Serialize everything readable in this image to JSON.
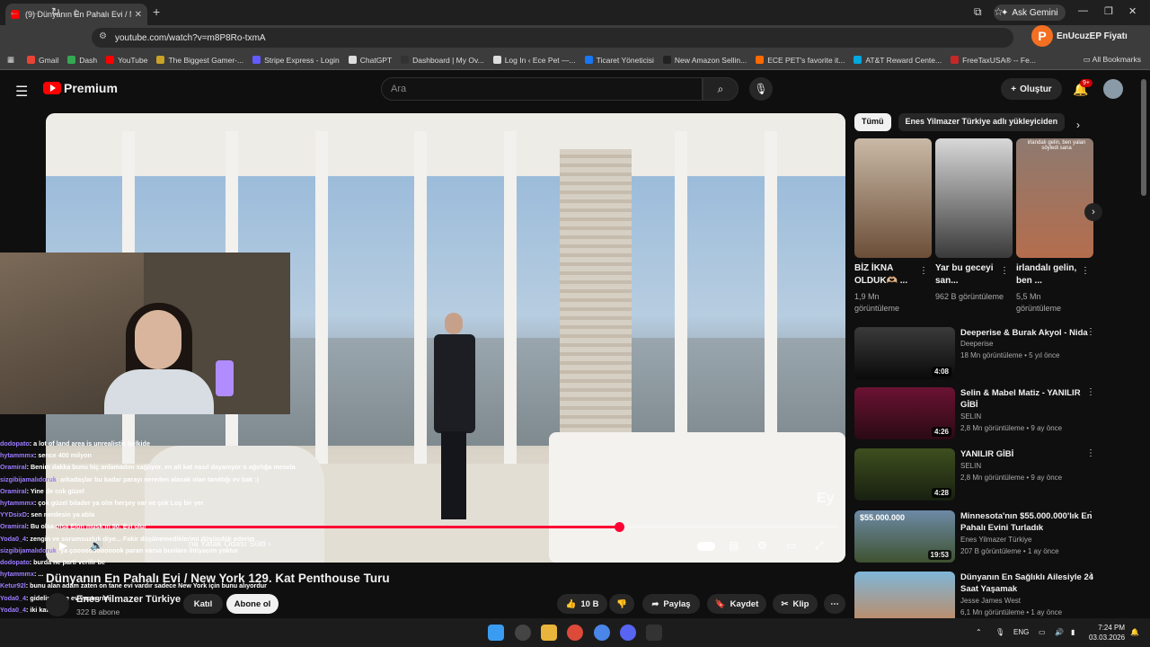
{
  "browser": {
    "tab_title": "(9) Dünyanın En Pahalı Evi / New",
    "url": "youtube.com/watch?v=m8P8Ro-txmA",
    "ask_gemini": "Ask Gemini",
    "extension_label": "EnUcuzEP Fiyatı",
    "bookmarks": [
      "Gmail",
      "Dash",
      "YouTube",
      "The Biggest Gamer-...",
      "Stripe Express - Login",
      "ChatGPT",
      "Dashboard | My Ov...",
      "Log In ‹ Ece Pet —...",
      "Ticaret Yöneticisi",
      "New Amazon Sellin...",
      "ECE PET's favorite it...",
      "AT&T Reward Cente...",
      "FreeTaxUSA® -- Fe..."
    ],
    "all_bookmarks": "All Bookmarks"
  },
  "youtube": {
    "logo": "Premium",
    "search_placeholder": "Ara",
    "create_label": "Oluştur",
    "notif_badge": "9+"
  },
  "player": {
    "progress_fraction": 0.72,
    "chapter": "na Yatak Odası Süiti",
    "watermark": "Ey"
  },
  "video": {
    "title": "Dünyanın En Pahalı Evi / New York 129. Kat Penthouse Turu",
    "channel": "Enes Yilmazer Türkiye",
    "subscribers": "322 B abone",
    "join_label": "Katıl",
    "subscribe_label": "Abone ol",
    "likes": "10 B",
    "share_label": "Paylaş",
    "save_label": "Kaydet",
    "clip_label": "Klip"
  },
  "chat": [
    {
      "user": "dodopato",
      "text": ": a lot of land area is unrealistic belkide"
    },
    {
      "user": "hytammmx",
      "text": ": sence 400 milyon"
    },
    {
      "user": "Oramiral",
      "text": ": Benim dakka bunu hiç anlamadım sağlıyor. en alt kat nasıl dayanıyor o ağırlığa mesela"
    },
    {
      "user": "sizgibijamalıdoruk",
      "text": ": arkadaşlar bu kadar parayı nereden alacak olan tanıttığı ev bak :)"
    },
    {
      "user": "Oramiral",
      "text": ": Yine de cok güzel"
    },
    {
      "user": "hytammmx",
      "text": ": çok güzel bilader ya olm herşey var ve çok Loş bir yer"
    },
    {
      "user": "YYDsixD",
      "text": ": sen nerdesin ya abla"
    },
    {
      "user": "Oramiral",
      "text": ": Bu olsa olsa Elon musk'ın 50. Evi olur"
    },
    {
      "user": "Yoda0_4",
      "text": ": zengin ve sorumsuzluk diye... Fakir düşünemediklerimi düşündük ederim"
    },
    {
      "user": "sizgibijamalıdoruk",
      "text": ": ya çooooooooooook paran varsa bunlara ihtiyacım yoktur"
    },
    {
      "user": "dodopato",
      "text": ": burda ne parti verilir be"
    },
    {
      "user": "hytammmx",
      "text": ": ..."
    },
    {
      "user": "Ketur92l",
      "text": ": bunu alan adam zaten on tane evi vardır sadece New York için bunu alıyordur"
    },
    {
      "user": "Yoda0_4",
      "text": ": gidelim köye ev yaptırırım"
    },
    {
      "user": "Yoda0_4",
      "text": ": iki katlı"
    },
    {
      "user": "hytammmx",
      "text": ": gece kondumu olsun abla tek gözlü"
    },
    {
      "user": "hytammmx",
      "text": ": jfjfjvjv"
    }
  ],
  "sidebar": {
    "chips": [
      "Tümü",
      "Enes Yilmazer Türkiye adlı yükleyiciden"
    ],
    "shorts": [
      {
        "title": "BİZ İKNA OLDUK🫶🏼 ...",
        "views": "1,9 Mn görüntüleme"
      },
      {
        "title": "Yar bu geceyi san...",
        "views": "962 B görüntüleme"
      },
      {
        "title": "irlandalı gelin, ben ...",
        "views": "5,5 Mn görüntüleme",
        "overlay": "irlandalı gelin, ben yalan söyledi sana"
      }
    ],
    "recommended": [
      {
        "title": "Deeperise & Burak Akyol - Nida",
        "channel": "Deeperise",
        "meta": "18 Mn görüntüleme • 5 yıl önce",
        "duration": "4:08"
      },
      {
        "title": "Selin & Mabel Matiz - YANILIR GİBİ",
        "channel": "SELIN",
        "meta": "2,8 Mn görüntüleme • 9 ay önce",
        "duration": "4:26"
      },
      {
        "title": "YANILIR GİBİ",
        "channel": "SELIN",
        "meta": "2,8 Mn görüntüleme • 9 ay önce",
        "duration": "4:28"
      },
      {
        "title": "Minnesota'nın $55.000.000'lık En Pahalı Evini Turladık",
        "channel": "Enes Yilmazer Türkiye",
        "meta": "207 B görüntüleme • 1 ay önce",
        "duration": "19:53",
        "overlay": "$55.000.000"
      },
      {
        "title": "Dünyanın En Sağlıklı Ailesiyle 24 Saat Yaşamak",
        "channel": "Jesse James West",
        "meta": "6,1 Mn görüntüleme • 1 ay önce",
        "duration": ""
      }
    ]
  },
  "taskbar": {
    "lang": "ENG",
    "time": "7:24 PM",
    "date": "03.03.2026"
  }
}
